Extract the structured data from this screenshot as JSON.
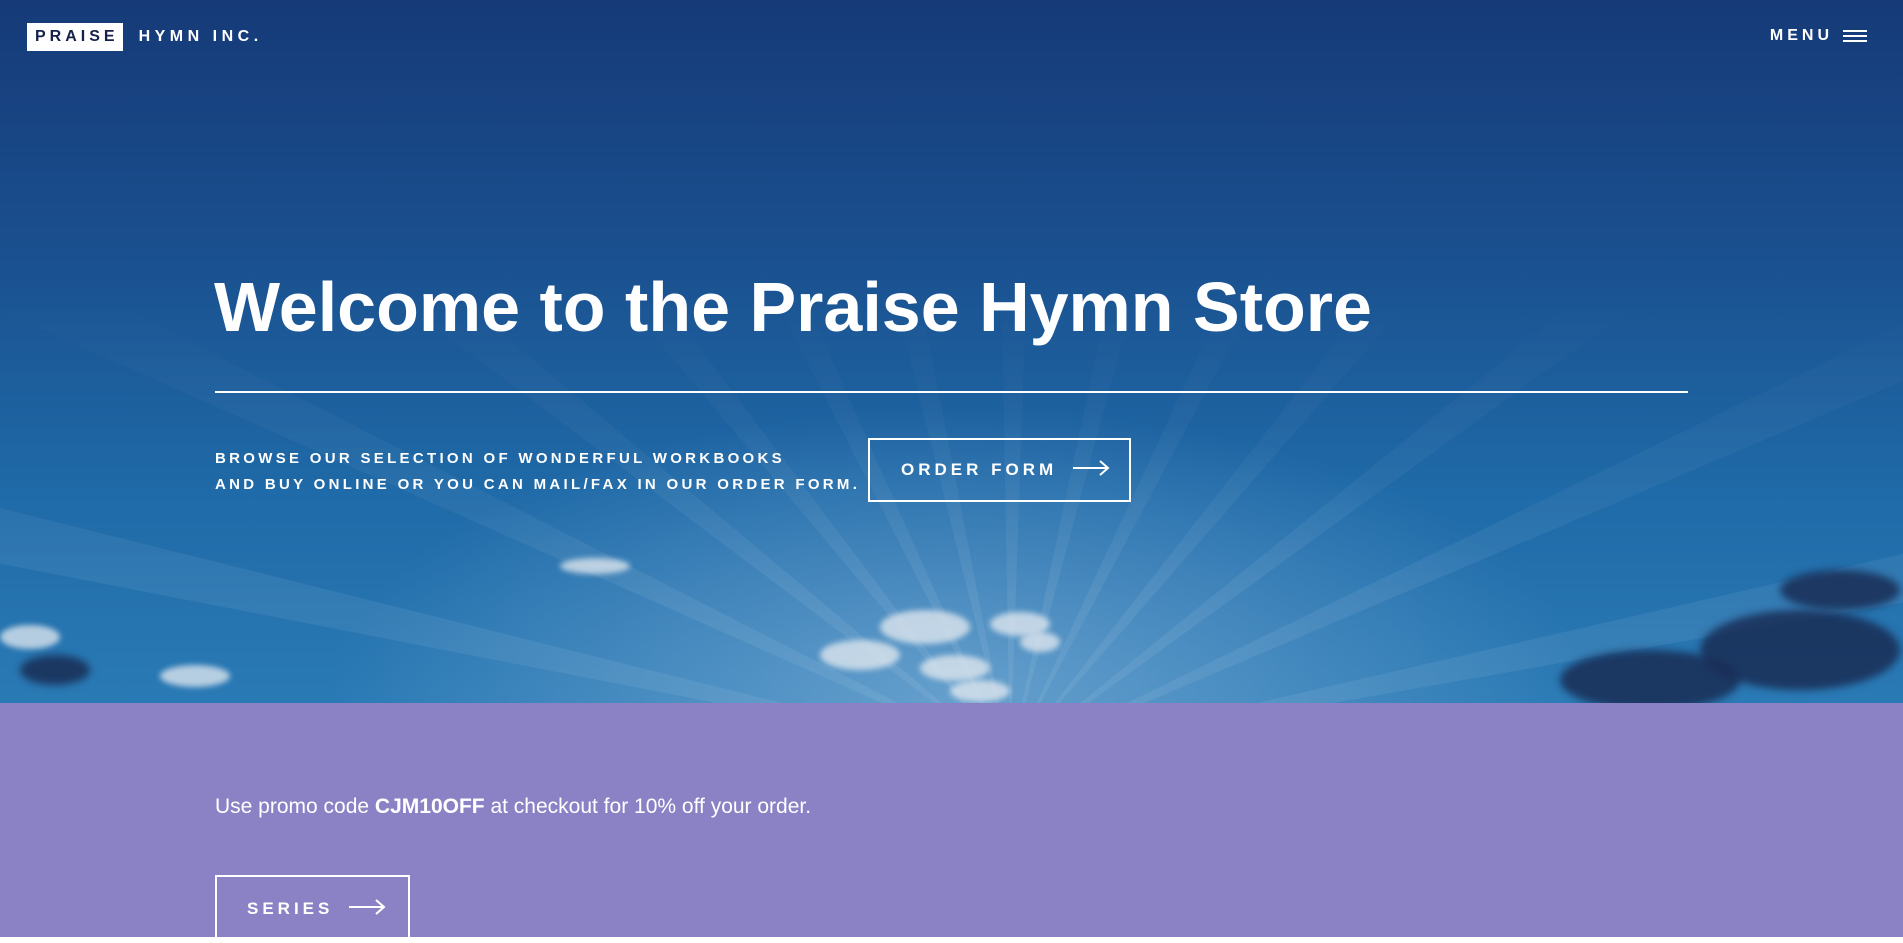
{
  "header": {
    "logo_box": "PRAISE",
    "logo_rest": "HYMN INC.",
    "menu_label": "MENU",
    "menu_icon": "hamburger-icon"
  },
  "hero": {
    "title": "Welcome to the Praise Hymn Store",
    "subtitle_line1": "BROWSE OUR SELECTION OF WONDERFUL WORKBOOKS",
    "subtitle_line2": "AND BUY ONLINE OR YOU CAN MAIL/FAX IN OUR ORDER FORM.",
    "order_button": "ORDER FORM",
    "order_button_icon": "arrow-right-icon"
  },
  "promo": {
    "text_before": "Use promo code ",
    "code": "CJM10OFF",
    "text_after": " at checkout for 10% off your order.",
    "series_button": "SERIES",
    "series_button_icon": "arrow-right-icon",
    "background_color": "#8b82c5"
  },
  "colors": {
    "sky_top": "#163a78",
    "sky_bottom": "#2a7ab5",
    "text": "#ffffff"
  }
}
